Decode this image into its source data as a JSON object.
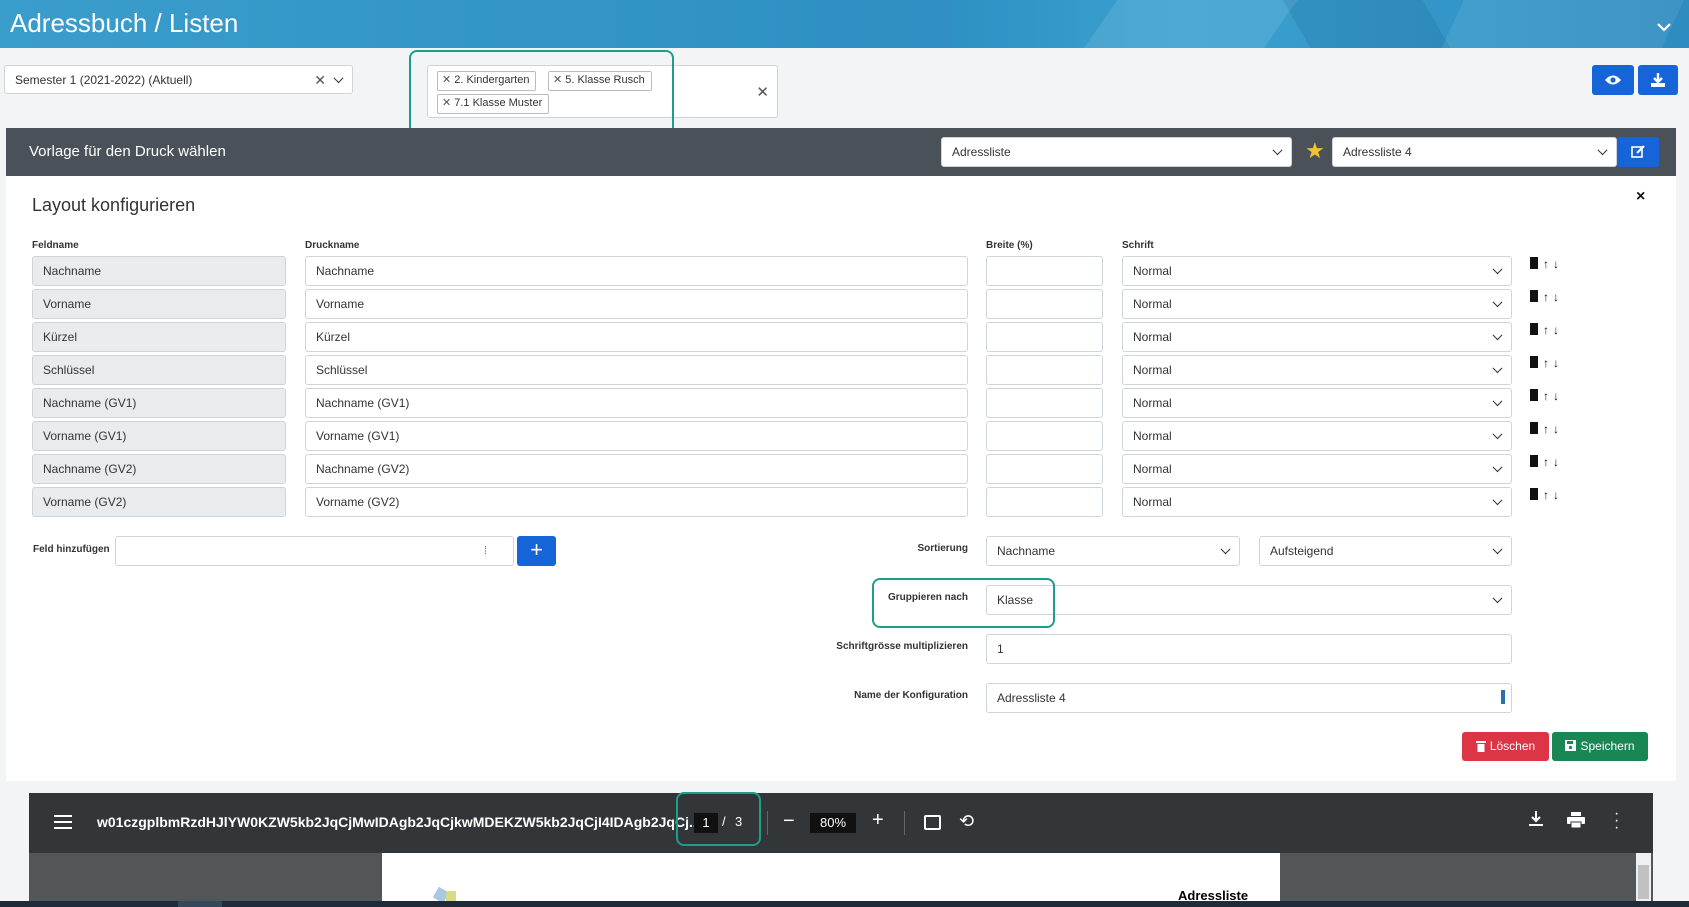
{
  "header": {
    "title": "Adressbuch / Listen"
  },
  "filters": {
    "semester": "Semester 1 (2021-2022) (Aktuell)",
    "classes": [
      "2. Kindergarten",
      "5. Klasse Rusch",
      "7.1 Klasse Muster"
    ]
  },
  "template": {
    "label": "Vorlage für den Druck wählen",
    "type_value": "Adressliste",
    "config_value": "Adressliste 4"
  },
  "layout": {
    "title": "Layout konfigurieren",
    "columns": {
      "feldname": "Feldname",
      "druckname": "Druckname",
      "breite": "Breite (%)",
      "schrift": "Schrift"
    },
    "rows": [
      {
        "feld": "Nachname",
        "druck": "Nachname",
        "breite": "",
        "schrift": "Normal"
      },
      {
        "feld": "Vorname",
        "druck": "Vorname",
        "breite": "",
        "schrift": "Normal"
      },
      {
        "feld": "Kürzel",
        "druck": "Kürzel",
        "breite": "",
        "schrift": "Normal"
      },
      {
        "feld": "Schlüssel",
        "druck": "Schlüssel",
        "breite": "",
        "schrift": "Normal"
      },
      {
        "feld": "Nachname (GV1)",
        "druck": "Nachname (GV1)",
        "breite": "",
        "schrift": "Normal"
      },
      {
        "feld": "Vorname (GV1)",
        "druck": "Vorname (GV1)",
        "breite": "",
        "schrift": "Normal"
      },
      {
        "feld": "Nachname (GV2)",
        "druck": "Nachname (GV2)",
        "breite": "",
        "schrift": "Normal"
      },
      {
        "feld": "Vorname (GV2)",
        "druck": "Vorname (GV2)",
        "breite": "",
        "schrift": "Normal"
      }
    ],
    "add_field_label": "Feld hinzufügen",
    "sort_label": "Sortierung",
    "sort_field": "Nachname",
    "sort_order": "Aufsteigend",
    "group_label": "Gruppieren nach",
    "group_value": "Klasse",
    "font_mult_label": "Schriftgrösse multiplizieren",
    "font_mult_value": "1",
    "config_name_label": "Name der Konfiguration",
    "config_name_value": "Adressliste 4",
    "delete_label": "Löschen",
    "save_label": "Speichern"
  },
  "pdf": {
    "filename": "w01czgplbmRzdHJlYW0KZW5kb2JqCjMwIDAgb2JqCjkwMDEKZW5kb2JqCjI4IDAgb2JqCj...",
    "page_current": "1",
    "page_sep": "/",
    "page_total": "3",
    "zoom": "80%",
    "page_heading": "Adressliste"
  },
  "icons": {
    "close": "×",
    "clear": "✕",
    "eye": "eye-icon",
    "download": "download-icon",
    "star": "★",
    "edit": "edit-icon",
    "trash": "trash-icon",
    "up": "↑",
    "down": "↓"
  },
  "colors": {
    "primary": "#1565d8",
    "danger": "#dc3545",
    "success": "#198754",
    "highlight": "#1e9e8a",
    "star": "#f4c430"
  }
}
